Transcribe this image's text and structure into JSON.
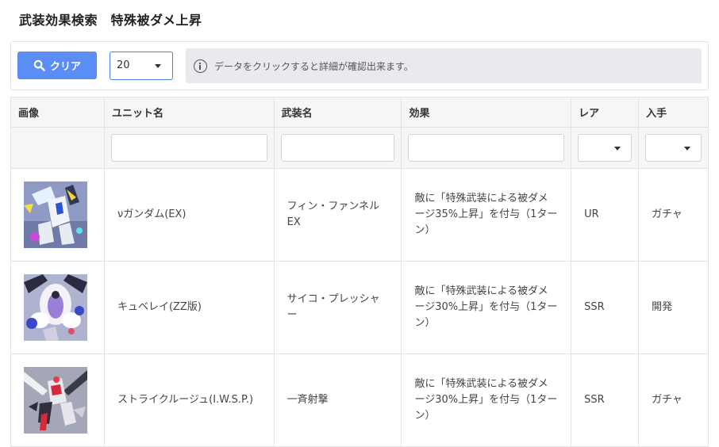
{
  "title": "武装効果検索　特殊被ダメ上昇",
  "toolbar": {
    "clear_label": "クリア",
    "page_size": "20",
    "info_text": "データをクリックすると詳細が確認出来ます。"
  },
  "table": {
    "headers": {
      "image": "画像",
      "unit": "ユニット名",
      "weapon": "武装名",
      "effect": "効果",
      "rarity": "レア",
      "source": "入手"
    },
    "rows": [
      {
        "unit": "νガンダム(EX)",
        "weapon": "フィン・ファンネルEX",
        "effect": "敵に「特殊武装による被ダメージ35%上昇」を付与（1ターン）",
        "rarity": "UR",
        "source": "ガチャ"
      },
      {
        "unit": "キュベレイ(ZZ版)",
        "weapon": "サイコ・プレッシャー",
        "effect": "敵に「特殊武装による被ダメージ30%上昇」を付与（1ターン）",
        "rarity": "SSR",
        "source": "開発"
      },
      {
        "unit": "ストライクルージュ(I.W.S.P.)",
        "weapon": "一斉射撃",
        "effect": "敵に「特殊武装による被ダメージ30%上昇」を付与（1ターン）",
        "rarity": "SSR",
        "source": "ガチャ"
      }
    ]
  },
  "colors": {
    "accent": "#5b8ef5",
    "header_bg": "#f5f6f8",
    "info_bg": "#e9eaee"
  }
}
